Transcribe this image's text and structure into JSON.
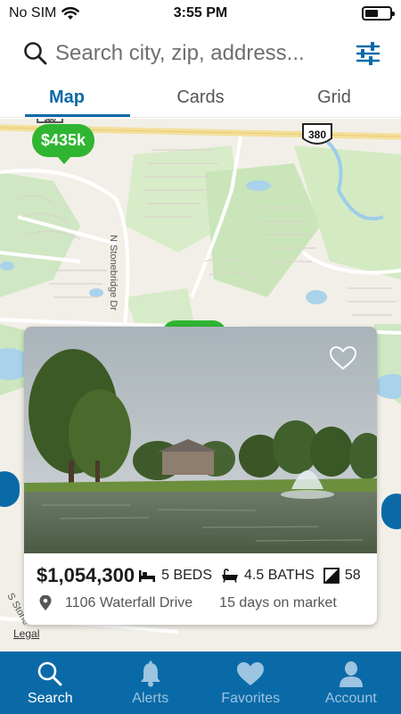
{
  "status_bar": {
    "carrier": "No SIM",
    "time": "3:55 PM",
    "battery_level": 0.55
  },
  "search": {
    "placeholder": "Search city, zip, address...",
    "icon": "search-icon",
    "filter_icon": "sliders-icon"
  },
  "tabs": [
    {
      "label": "Map",
      "active": true
    },
    {
      "label": "Cards",
      "active": false
    },
    {
      "label": "Grid",
      "active": false
    }
  ],
  "map": {
    "pin_price": "$435k",
    "street_label": "N Stonebridge Dr",
    "street_label_2": "S Stone",
    "highway_shield": "380",
    "highway_shield_2": "380",
    "legal_link": "Legal"
  },
  "listing": {
    "price": "$1,054,300",
    "beds": "5 BEDS",
    "baths": "4.5 BATHS",
    "sqft": "58",
    "address": "1106 Waterfall Drive",
    "days_on_market": "15 days on market",
    "favorite_icon": "heart-outline-icon"
  },
  "bottom_nav": [
    {
      "label": "Search",
      "icon": "search-icon",
      "active": true
    },
    {
      "label": "Alerts",
      "icon": "bell-icon",
      "active": false
    },
    {
      "label": "Favorites",
      "icon": "heart-icon",
      "active": false
    },
    {
      "label": "Account",
      "icon": "person-icon",
      "active": false
    }
  ],
  "colors": {
    "brand_blue": "#0a6aa8",
    "pin_green": "#2fb532"
  }
}
